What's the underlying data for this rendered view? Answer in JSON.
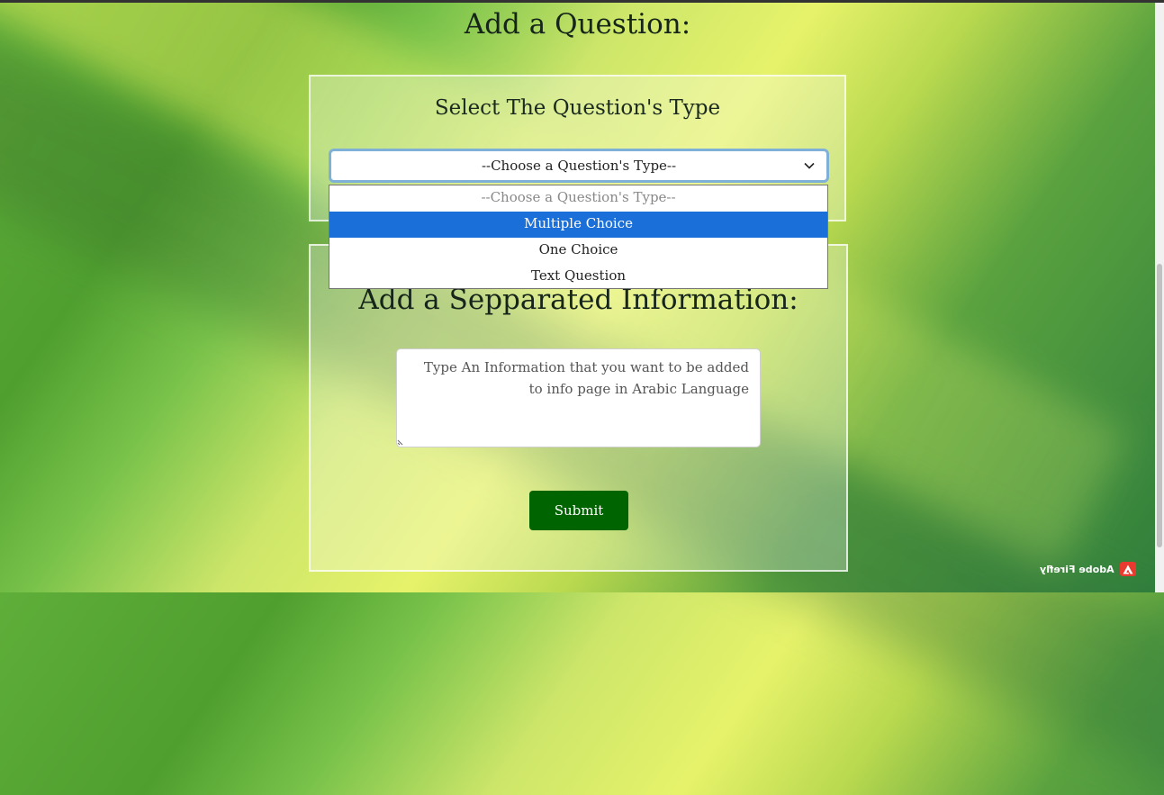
{
  "page": {
    "heading": "Add a Question:"
  },
  "question_type_card": {
    "title": "Select The Question's Type",
    "select": {
      "value": "--Choose a Question's Type--",
      "options": [
        {
          "label": "--Choose a Question's Type--",
          "state": "placeholder"
        },
        {
          "label": "Multiple Choice",
          "state": "highlighted"
        },
        {
          "label": "One Choice",
          "state": "normal"
        },
        {
          "label": "Text Question",
          "state": "normal"
        }
      ]
    }
  },
  "info_card": {
    "title": "Add a Sepparated Information:",
    "textarea_placeholder": "Type An Information that you want to be added to info page in Arabic Language",
    "submit_label": "Submit"
  },
  "watermark": {
    "text": "Adobe Firefly",
    "icon": "adobe-logo-icon"
  },
  "colors": {
    "submit_bg": "#006400",
    "option_highlight": "#1b6fd9",
    "select_focus_border": "#7fb1d8"
  }
}
